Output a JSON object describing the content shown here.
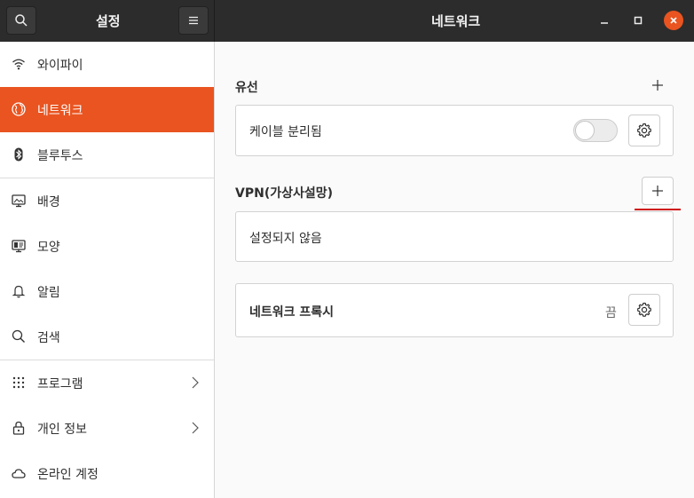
{
  "header": {
    "settings_title": "설정",
    "page_title": "네트워크"
  },
  "sidebar": {
    "items": [
      {
        "label": "와이파이",
        "icon": "wifi-icon"
      },
      {
        "label": "네트워크",
        "icon": "globe-icon",
        "active": true
      },
      {
        "label": "블루투스",
        "icon": "bluetooth-icon"
      },
      {
        "label": "배경",
        "icon": "monitor-background-icon"
      },
      {
        "label": "모양",
        "icon": "appearance-icon"
      },
      {
        "label": "알림",
        "icon": "bell-icon"
      },
      {
        "label": "검색",
        "icon": "search-icon"
      },
      {
        "label": "프로그램",
        "icon": "apps-grid-icon",
        "chevron": true
      },
      {
        "label": "개인 정보",
        "icon": "lock-icon",
        "chevron": true
      },
      {
        "label": "온라인 계정",
        "icon": "cloud-icon"
      }
    ]
  },
  "main": {
    "wired": {
      "title": "유선",
      "cable_status": "케이블 분리됨",
      "toggle_on": false
    },
    "vpn": {
      "title": "VPN(가상사설망)",
      "empty_text": "설정되지 않음"
    },
    "proxy": {
      "label": "네트워크 프록시",
      "status": "끔"
    }
  },
  "colors": {
    "accent": "#e95420",
    "header_bg": "#2c2c2c",
    "highlight_underline": "#d01010"
  }
}
